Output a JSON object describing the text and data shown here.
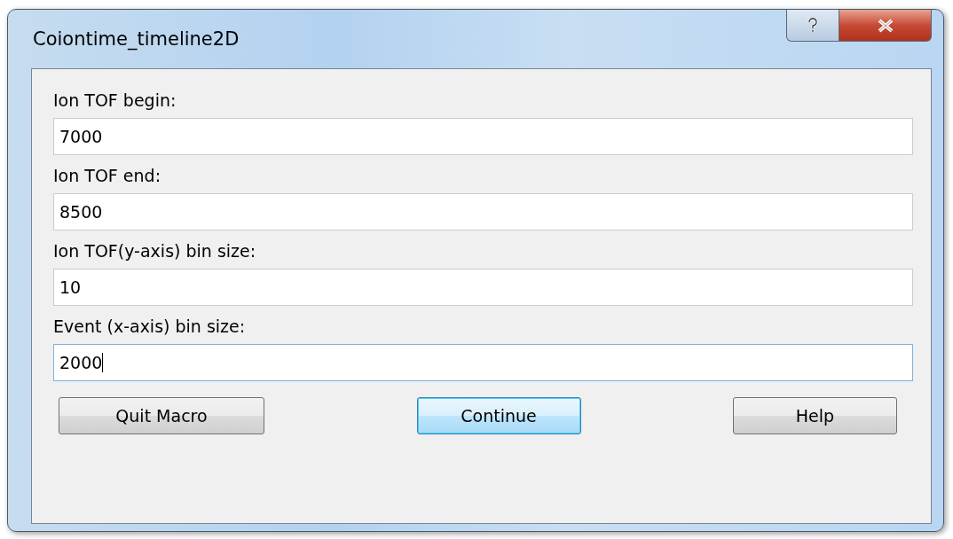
{
  "window": {
    "title": "Coiontime_timeline2D"
  },
  "fields": [
    {
      "label": "Ion TOF begin:",
      "value": "7000",
      "focused": false
    },
    {
      "label": "Ion TOF end:",
      "value": "8500",
      "focused": false
    },
    {
      "label": "Ion TOF(y-axis) bin size:",
      "value": "10",
      "focused": false
    },
    {
      "label": "Event (x-axis) bin size:",
      "value": "2000",
      "focused": true
    }
  ],
  "buttons": [
    {
      "label": "Quit Macro",
      "default": false
    },
    {
      "label": "Continue",
      "default": true
    },
    {
      "label": "Help",
      "default": false
    }
  ]
}
